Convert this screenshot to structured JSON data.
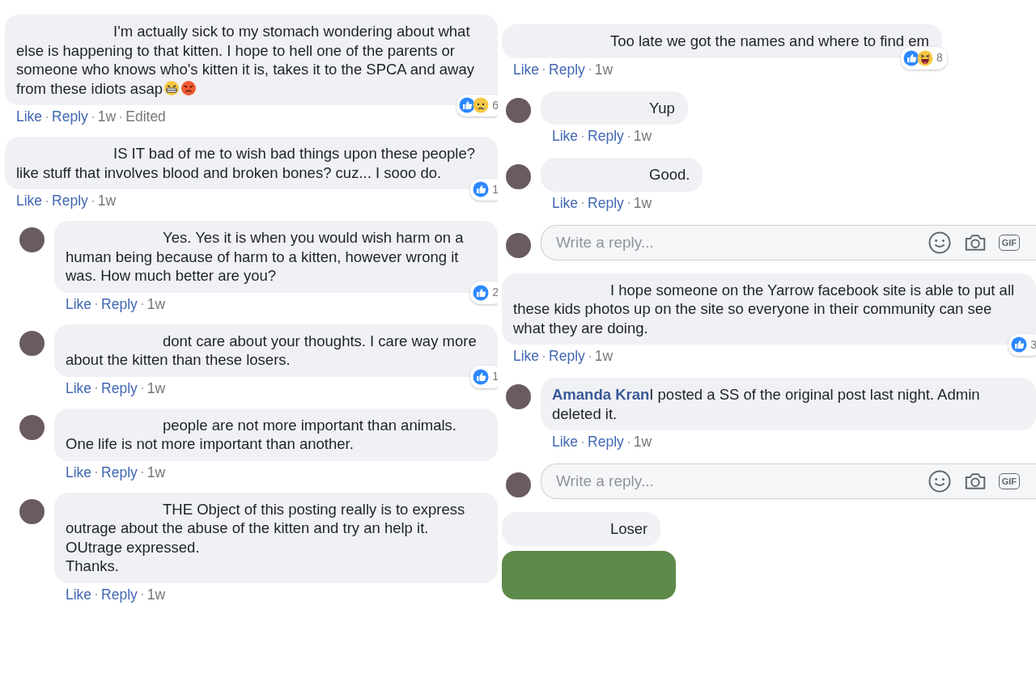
{
  "columns": [
    {
      "items": [
        {
          "kind": "comment",
          "avatar": false,
          "name_hidden": true,
          "text": "I'm actually sick to my stomach wondering about what else is happening to that kitten. I hope to hell one of the parents or someone who knows who's kitten it is, takes it to the SPCA and away from these idiots asap",
          "emojis": [
            {
              "kind": "grimace"
            },
            {
              "kind": "angry"
            }
          ],
          "reactions": {
            "kinds": [
              {
                "kind": "like"
              },
              {
                "kind": "sad"
              }
            ],
            "count": "6"
          },
          "like": "Like",
          "reply": "Reply",
          "time": "1w",
          "edited": "Edited"
        },
        {
          "kind": "comment",
          "avatar": false,
          "name_hidden": true,
          "text": "IS IT bad of me to wish bad things upon these people? like stuff that involves blood and broken bones? cuz... I sooo do.",
          "reactions": {
            "kinds": [
              {
                "kind": "like"
              }
            ],
            "count": "1"
          },
          "like": "Like",
          "reply": "Reply",
          "time": "1w"
        },
        {
          "kind": "comment",
          "avatar": true,
          "name_hidden": true,
          "text": "Yes. Yes it is when you would wish harm on a human being because of harm to a kitten, however wrong it was. How much better are you?",
          "reactions": {
            "kinds": [
              {
                "kind": "like"
              }
            ],
            "count": "2"
          },
          "like": "Like",
          "reply": "Reply",
          "time": "1w"
        },
        {
          "kind": "comment",
          "avatar": true,
          "name_hidden": true,
          "text": "dont care about your thoughts. I care way more about the kitten than these losers.",
          "reactions": {
            "kinds": [
              {
                "kind": "like"
              }
            ],
            "count": "1"
          },
          "like": "Like",
          "reply": "Reply",
          "time": "1w"
        },
        {
          "kind": "comment",
          "avatar": true,
          "name_hidden": true,
          "text": "people are not more important than animals. One life is not more important than another.",
          "like": "Like",
          "reply": "Reply",
          "time": "1w"
        },
        {
          "kind": "comment",
          "avatar": true,
          "name_hidden": true,
          "text": "THE Object of this posting really is to express outrage about the abuse of the kitten and try an help it. OUtrage expressed.\nThanks.",
          "like": "Like",
          "reply": "Reply",
          "time": "1w"
        }
      ]
    },
    {
      "items": [
        {
          "kind": "comment",
          "avatar": false,
          "name_hidden": true,
          "text": "Too late we got the names and where to find em",
          "reactions": {
            "kinds": [
              {
                "kind": "like"
              },
              {
                "kind": "haha"
              }
            ],
            "count": "8"
          },
          "like": "Like",
          "reply": "Reply",
          "time": "1w"
        },
        {
          "kind": "comment",
          "avatar": true,
          "name_hidden": true,
          "text": "Yup",
          "like": "Like",
          "reply": "Reply",
          "time": "1w"
        },
        {
          "kind": "comment",
          "avatar": true,
          "name_hidden": true,
          "text": "Good.",
          "like": "Like",
          "reply": "Reply",
          "time": "1w"
        },
        {
          "kind": "reply_box",
          "placeholder": "Write a reply...",
          "gif": "GIF"
        },
        {
          "kind": "comment",
          "avatar": false,
          "name_hidden": true,
          "text": "I hope someone on the Yarrow facebook site is able to put all these kids photos up on the site so everyone in their community can see what they are doing.",
          "reactions": {
            "kinds": [
              {
                "kind": "like"
              }
            ],
            "count": "3"
          },
          "like": "Like",
          "reply": "Reply",
          "time": "1w"
        },
        {
          "kind": "comment",
          "avatar": true,
          "author": "Amanda Kran",
          "text": "I posted a SS of the original post last night. Admin deleted it.",
          "like": "Like",
          "reply": "Reply",
          "time": "1w"
        },
        {
          "kind": "reply_box",
          "placeholder": "Write a reply...",
          "gif": "GIF"
        },
        {
          "kind": "comment",
          "avatar": false,
          "name_hidden": true,
          "text": "Loser"
        },
        {
          "kind": "photo"
        }
      ]
    }
  ]
}
